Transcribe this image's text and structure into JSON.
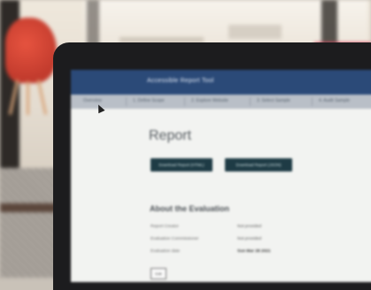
{
  "app": {
    "header_title": "Accessible Report Tool",
    "nav_items": [
      "Overview",
      "1. Define Scope",
      "2. Explore Website",
      "3. Select Sample",
      "4. Audit Sample"
    ]
  },
  "page": {
    "title": "Report",
    "buttons": {
      "download_html": "Download Report (HTML)",
      "download_json": "Download Report (JSON)"
    },
    "section_title": "About the Evaluation",
    "rows": [
      {
        "label": "Report Creator",
        "value": "Not provided"
      },
      {
        "label": "Evaluation Commissioner",
        "value": "Not provided"
      },
      {
        "label": "Evaluation date",
        "value": "Sun Mar 28 2021"
      }
    ],
    "edit_label": "Edit"
  },
  "colors": {
    "header": "#2b4a78",
    "button": "#1e3b45",
    "bezel": "#1c1c1e",
    "chair": "#c23b2d",
    "accent_pink": "#d7445e"
  }
}
